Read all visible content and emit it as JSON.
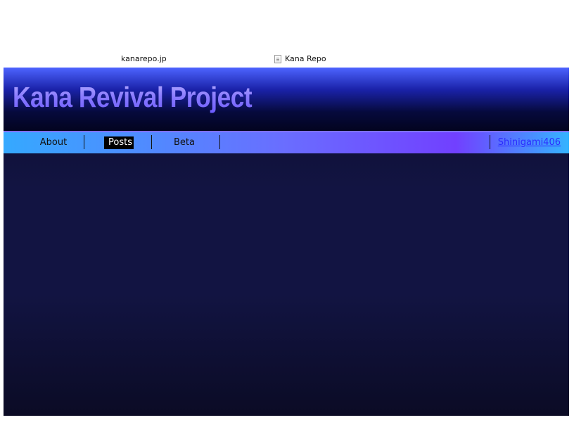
{
  "browser": {
    "url": "kanarepo.jp",
    "tab_title": "Kana Repo"
  },
  "site": {
    "title": "Kana Revival Project"
  },
  "nav": {
    "items": [
      {
        "label": "About",
        "active": false
      },
      {
        "label": "Posts",
        "active": true
      },
      {
        "label": "Beta",
        "active": false
      }
    ],
    "user": "Shinigami406"
  },
  "colors": {
    "header_gradient": [
      "#4d63ff",
      "#03041f"
    ],
    "nav_gradient": [
      "#35a9ff",
      "#7140ff"
    ],
    "body_bg": "#121442",
    "title_color": "#8c7dff",
    "link": "#2b2bff"
  },
  "icons": {
    "tab_icon": "page-icon"
  }
}
